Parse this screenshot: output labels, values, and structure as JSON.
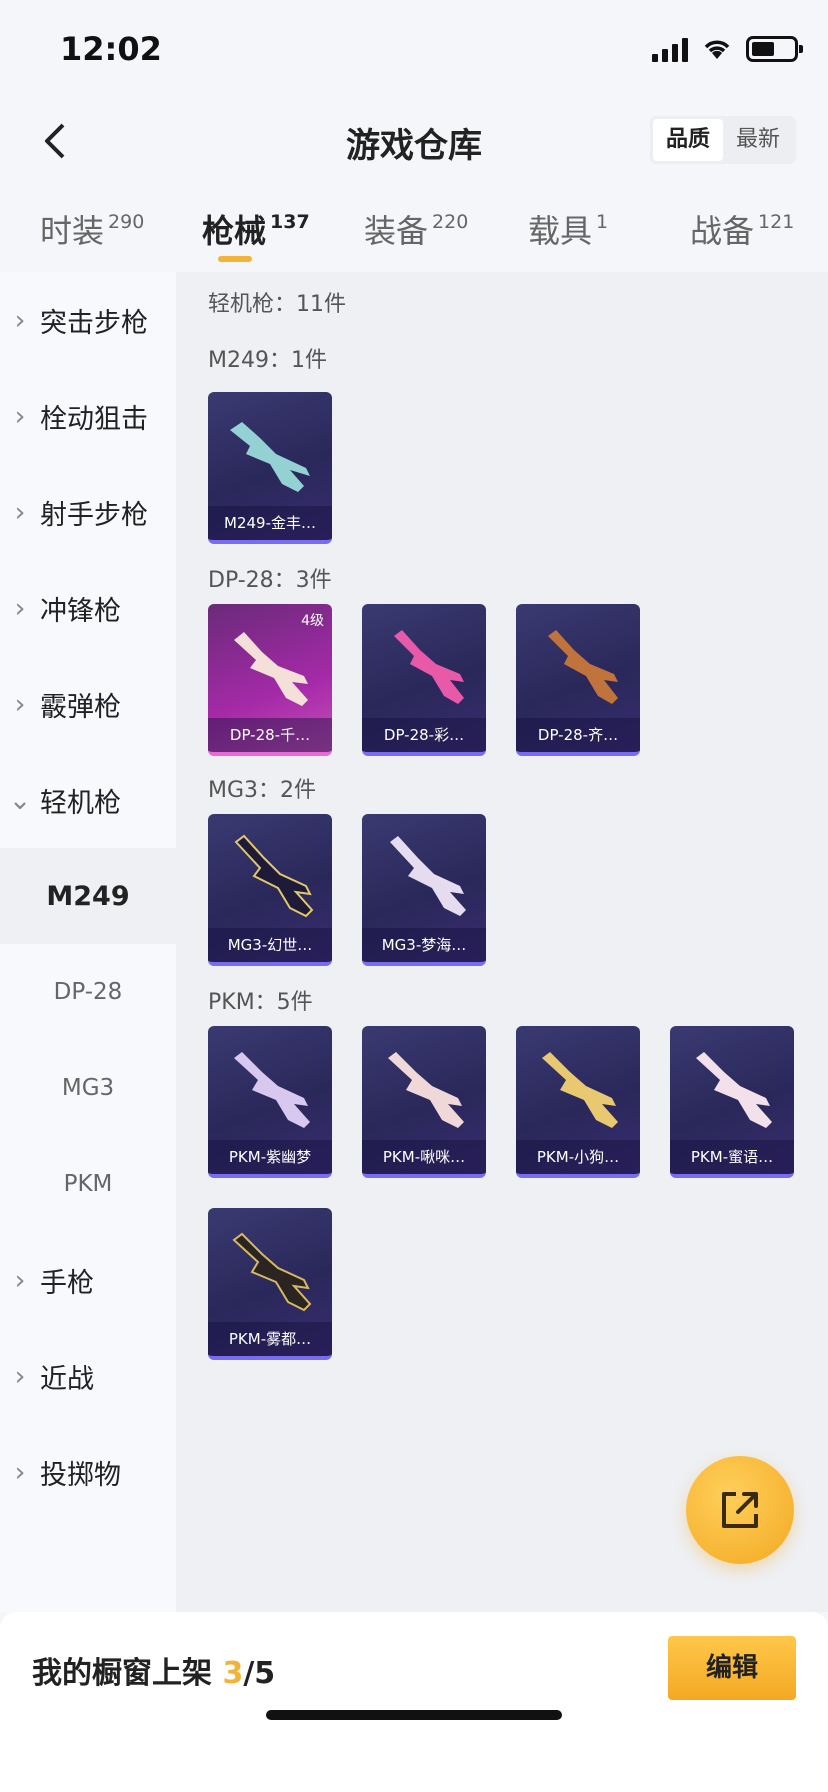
{
  "status": {
    "time": "12:02"
  },
  "header": {
    "title": "游戏仓库",
    "sort_options": [
      "品质",
      "最新"
    ],
    "sort_active": "品质"
  },
  "tabs": [
    {
      "label": "时装",
      "count": "290"
    },
    {
      "label": "枪械",
      "count": "137"
    },
    {
      "label": "装备",
      "count": "220"
    },
    {
      "label": "载具",
      "count": "1"
    },
    {
      "label": "战备",
      "count": "121"
    }
  ],
  "sidebar": {
    "items": [
      {
        "label": "突击步枪"
      },
      {
        "label": "栓动狙击"
      },
      {
        "label": "射手步枪"
      },
      {
        "label": "冲锋枪"
      },
      {
        "label": "霰弹枪"
      },
      {
        "label": "轻机枪"
      },
      {
        "label": "M249"
      },
      {
        "label": "DP-28"
      },
      {
        "label": "MG3"
      },
      {
        "label": "PKM"
      },
      {
        "label": "手枪"
      },
      {
        "label": "近战"
      },
      {
        "label": "投掷物"
      }
    ]
  },
  "content": {
    "category_title": "轻机枪：11件",
    "groups": [
      {
        "title": "M249：1件",
        "items": [
          {
            "name": "M249-金丰…"
          }
        ]
      },
      {
        "title": "DP-28：3件",
        "items": [
          {
            "name": "DP-28-千…",
            "level": "4级"
          },
          {
            "name": "DP-28-彩…"
          },
          {
            "name": "DP-28-齐…"
          }
        ]
      },
      {
        "title": "MG3：2件",
        "items": [
          {
            "name": "MG3-幻世…"
          },
          {
            "name": "MG3-梦海…"
          }
        ]
      },
      {
        "title": "PKM：5件",
        "items": [
          {
            "name": "PKM-紫幽梦"
          },
          {
            "name": "PKM-啾咪…"
          },
          {
            "name": "PKM-小狗…"
          },
          {
            "name": "PKM-蜜语…"
          },
          {
            "name": "PKM-雾都…"
          }
        ]
      }
    ]
  },
  "bottom": {
    "showcase_label": "我的橱窗上架",
    "showcase_current": "3",
    "showcase_total": "/5",
    "edit_label": "编辑"
  },
  "colors": {
    "accent": "#f3b33b",
    "card_purple": "#2a285a",
    "card_pink": "#a52aa8"
  }
}
